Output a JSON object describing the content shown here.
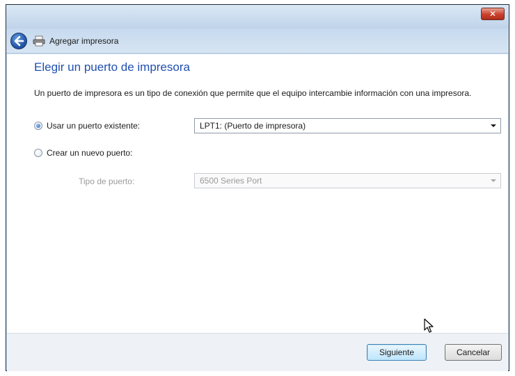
{
  "window": {
    "close_glyph": "✕",
    "title": "Agregar impresora"
  },
  "page": {
    "heading": "Elegir un puerto de impresora",
    "description": "Un puerto de impresora es un tipo de conexión que permite que el equipo intercambie información con una impresora."
  },
  "options": {
    "existing": {
      "label": "Usar un puerto existente:",
      "selected": true,
      "value": "LPT1: (Puerto de impresora)"
    },
    "new": {
      "label": "Crear un nuevo puerto:",
      "selected": false
    },
    "port_type": {
      "label": "Tipo de puerto:",
      "value": "6500 Series Port",
      "enabled": false
    }
  },
  "buttons": {
    "next": "Siguiente",
    "cancel": "Cancelar"
  },
  "colors": {
    "heading": "#1f4fb0",
    "titlebar": "#c9dcef",
    "close": "#c8402c"
  },
  "icons": {
    "back": "back-arrow-icon",
    "printer": "printer-icon",
    "cursor": "mouse-pointer-icon"
  }
}
